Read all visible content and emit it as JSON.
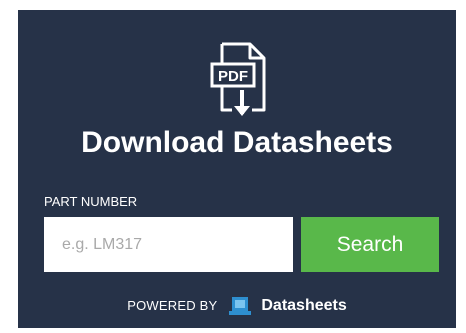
{
  "widget": {
    "icon": "pdf-download-icon",
    "pdf_icon_text": "PDF",
    "title": "Download Datasheets",
    "part_label": "PART NUMBER",
    "part_input": {
      "placeholder": "e.g. LM317",
      "value": ""
    },
    "search_label": "Search",
    "powered_by": "POWERED BY",
    "brand_icon": "datasheets-logo-icon",
    "brand_name": "Datasheets"
  },
  "colors": {
    "background": "#263248",
    "accent_green": "#59b84a",
    "brand_blue": "#2e8fd0",
    "text": "#ffffff"
  }
}
